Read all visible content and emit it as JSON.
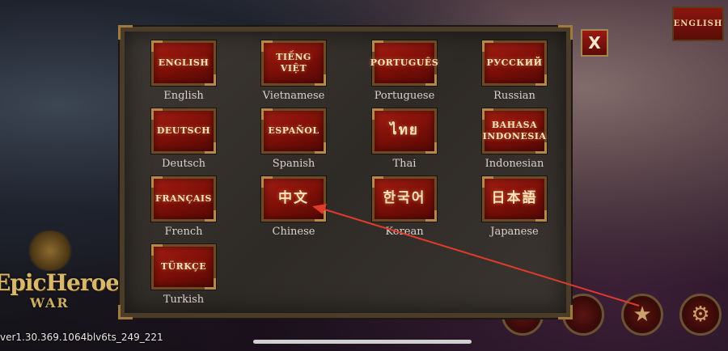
{
  "top_button": {
    "label": "English"
  },
  "close_button": {
    "label": "X"
  },
  "languages": [
    {
      "native": "English",
      "caption": "English"
    },
    {
      "native": "Tiếng Việt",
      "caption": "Vietnamese"
    },
    {
      "native": "Português",
      "caption": "Portuguese"
    },
    {
      "native": "Русский",
      "caption": "Russian"
    },
    {
      "native": "Deutsch",
      "caption": "Deutsch"
    },
    {
      "native": "Español",
      "caption": "Spanish"
    },
    {
      "native": "ไทย",
      "caption": "Thai"
    },
    {
      "native": "Bahasa Indonesia",
      "caption": "Indonesian"
    },
    {
      "native": "Français",
      "caption": "French"
    },
    {
      "native": "中文",
      "caption": "Chinese"
    },
    {
      "native": "한국어",
      "caption": "Korean"
    },
    {
      "native": "日本語",
      "caption": "Japanese"
    },
    {
      "native": "Türkçe",
      "caption": "Turkish"
    }
  ],
  "logo": {
    "line1": "EpicHeroes",
    "line2": "WAR"
  },
  "version_text": "ver1.30.369.1064blv6ts_249_221",
  "bottom_icons": [
    "star-icon",
    "gear-icon"
  ],
  "accent_color": "#e03a2a"
}
